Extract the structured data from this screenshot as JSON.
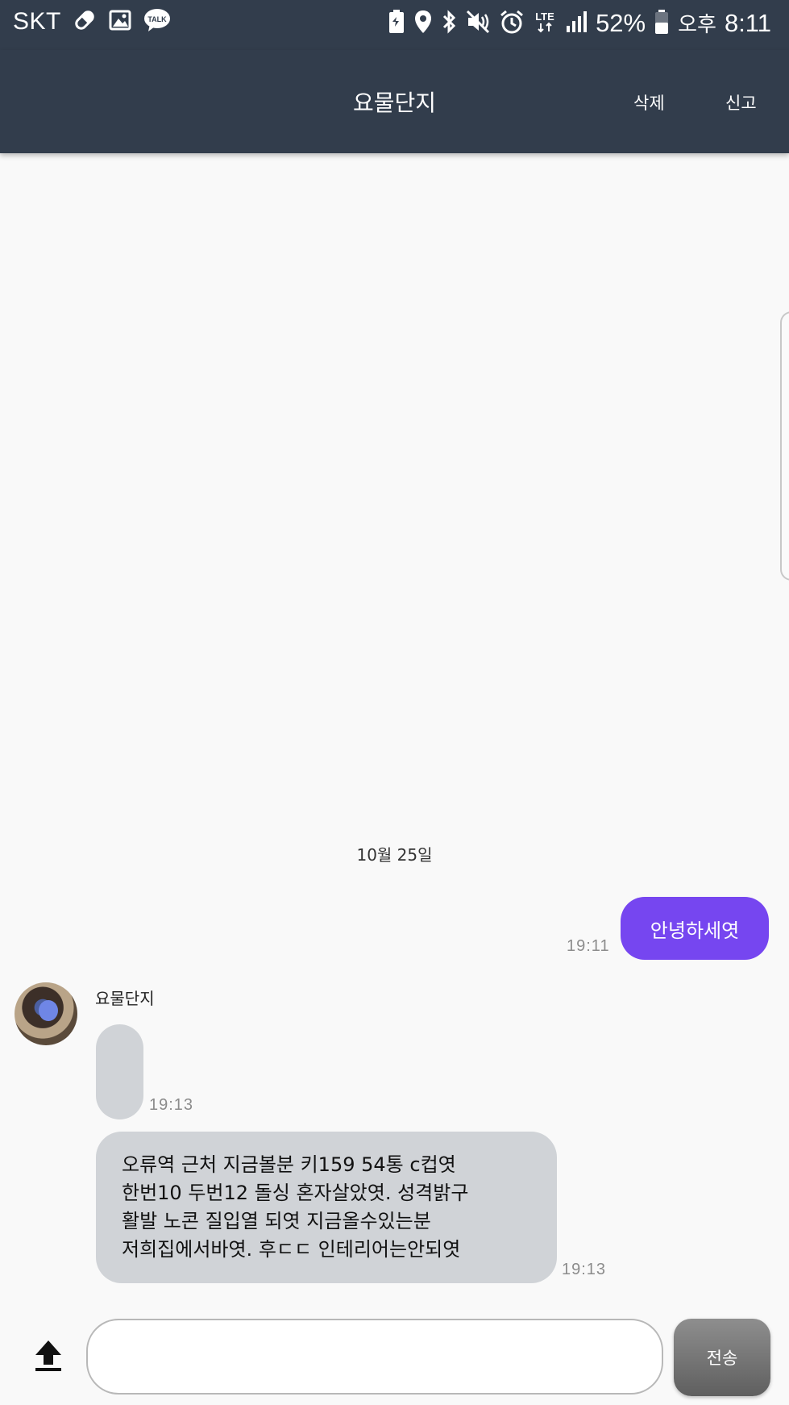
{
  "status_bar": {
    "carrier": "SKT",
    "network": "LTE",
    "battery": "52%",
    "ampm": "오후",
    "time": "8:11",
    "left_icons": [
      "pill-icon",
      "image-icon",
      "kakaotalk-icon"
    ],
    "kakao_label": "TALK",
    "right_icons": [
      "battery-saver-icon",
      "location-icon",
      "bluetooth-icon",
      "mute-vibrate-icon",
      "alarm-icon",
      "lte-icon",
      "signal-icon",
      "battery-icon"
    ]
  },
  "app_bar": {
    "title": "요물단지",
    "delete_label": "삭제",
    "report_label": "신고"
  },
  "chat": {
    "date_separator": "10월 25일",
    "outgoing": {
      "text": "안녕하세엿",
      "time": "19:11"
    },
    "sender_name": "요물단지",
    "incoming_empty": {
      "time": "19:13"
    },
    "incoming": {
      "lines": [
        "오류역 근처 지금볼분 키159 54통 c컵엿",
        "한번10 두번12 돌싱 혼자살았엿. 성격밝구",
        "활발 노콘 질입열 되엿 지금올수있는분",
        "저희집에서바엿. 후ㄷㄷ 인테리어는안되엿"
      ],
      "time": "19:13"
    }
  },
  "composer": {
    "input_value": "",
    "input_placeholder": "",
    "send_label": "전송"
  },
  "colors": {
    "app_bar": "#323d4c",
    "outgoing_bubble": "#7646f0",
    "incoming_bubble": "#d0d3d7",
    "background": "#f9f9f9"
  }
}
